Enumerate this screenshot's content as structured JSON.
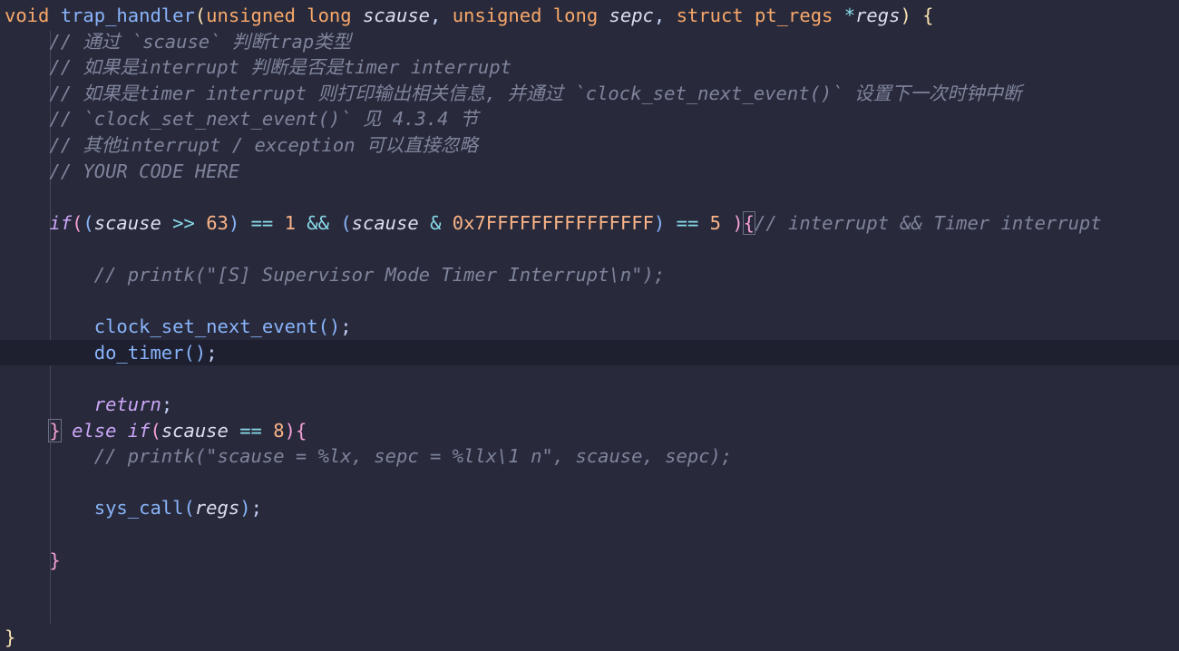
{
  "editor": {
    "lines": [
      {
        "id": "sig",
        "tokens": [
          {
            "c": "type",
            "t": "void"
          },
          {
            "c": "punct",
            "t": " "
          },
          {
            "c": "fn",
            "t": "trap_handler"
          },
          {
            "c": "brace-y",
            "t": "("
          },
          {
            "c": "type",
            "t": "unsigned long"
          },
          {
            "c": "punct",
            "t": " "
          },
          {
            "c": "param",
            "t": "scause"
          },
          {
            "c": "punct",
            "t": ", "
          },
          {
            "c": "type",
            "t": "unsigned long"
          },
          {
            "c": "punct",
            "t": " "
          },
          {
            "c": "param",
            "t": "sepc"
          },
          {
            "c": "punct",
            "t": ", "
          },
          {
            "c": "type",
            "t": "struct"
          },
          {
            "c": "punct",
            "t": " "
          },
          {
            "c": "type",
            "t": "pt_regs"
          },
          {
            "c": "punct",
            "t": " "
          },
          {
            "c": "op",
            "t": "*"
          },
          {
            "c": "param",
            "t": "regs"
          },
          {
            "c": "brace-y",
            "t": ")"
          },
          {
            "c": "punct",
            "t": " "
          },
          {
            "c": "brace-y",
            "t": "{"
          }
        ]
      },
      {
        "id": "c1",
        "tokens": [
          {
            "c": "cmt",
            "t": "    // 通过 `scause` 判断trap类型"
          }
        ]
      },
      {
        "id": "c2",
        "tokens": [
          {
            "c": "cmt",
            "t": "    // 如果是interrupt 判断是否是timer interrupt"
          }
        ]
      },
      {
        "id": "c3",
        "tokens": [
          {
            "c": "cmt",
            "t": "    // 如果是timer interrupt 则打印输出相关信息, 并通过 `clock_set_next_event()` 设置下一次时钟中断"
          }
        ]
      },
      {
        "id": "c4",
        "tokens": [
          {
            "c": "cmt",
            "t": "    // `clock_set_next_event()` 见 4.3.4 节"
          }
        ]
      },
      {
        "id": "c5",
        "tokens": [
          {
            "c": "cmt",
            "t": "    // 其他interrupt / exception 可以直接忽略"
          }
        ]
      },
      {
        "id": "c6",
        "tokens": [
          {
            "c": "cmt",
            "t": "    // YOUR CODE HERE"
          }
        ]
      },
      {
        "id": "blank1",
        "tokens": []
      },
      {
        "id": "if",
        "tokens": [
          {
            "c": "punct",
            "t": "    "
          },
          {
            "c": "kwi",
            "t": "if"
          },
          {
            "c": "brace-m",
            "t": "("
          },
          {
            "c": "brace-b",
            "t": "("
          },
          {
            "c": "param",
            "t": "scause"
          },
          {
            "c": "punct",
            "t": " "
          },
          {
            "c": "op",
            "t": ">>"
          },
          {
            "c": "punct",
            "t": " "
          },
          {
            "c": "num",
            "t": "63"
          },
          {
            "c": "brace-b",
            "t": ")"
          },
          {
            "c": "punct",
            "t": " "
          },
          {
            "c": "op",
            "t": "=="
          },
          {
            "c": "punct",
            "t": " "
          },
          {
            "c": "num",
            "t": "1"
          },
          {
            "c": "punct",
            "t": " "
          },
          {
            "c": "op",
            "t": "&&"
          },
          {
            "c": "punct",
            "t": " "
          },
          {
            "c": "brace-b",
            "t": "("
          },
          {
            "c": "param",
            "t": "scause"
          },
          {
            "c": "punct",
            "t": " "
          },
          {
            "c": "op",
            "t": "&"
          },
          {
            "c": "punct",
            "t": " "
          },
          {
            "c": "num",
            "t": "0x7FFFFFFFFFFFFFFF"
          },
          {
            "c": "brace-b",
            "t": ")"
          },
          {
            "c": "punct",
            "t": " "
          },
          {
            "c": "op",
            "t": "=="
          },
          {
            "c": "punct",
            "t": " "
          },
          {
            "c": "num",
            "t": "5"
          },
          {
            "c": "punct",
            "t": " "
          },
          {
            "c": "brace-m",
            "t": ")"
          },
          {
            "c": "brace-m bracket-match",
            "t": "{"
          },
          {
            "c": "cmt",
            "t": "// interrupt && Timer interrupt"
          }
        ]
      },
      {
        "id": "blank2",
        "tokens": []
      },
      {
        "id": "printk1",
        "tokens": [
          {
            "c": "cmt",
            "t": "        // printk(\"[S] Supervisor Mode Timer Interrupt\\n\");"
          }
        ]
      },
      {
        "id": "blank3",
        "tokens": []
      },
      {
        "id": "csne",
        "tokens": [
          {
            "c": "punct",
            "t": "        "
          },
          {
            "c": "fn",
            "t": "clock_set_next_event"
          },
          {
            "c": "brace-b",
            "t": "()"
          },
          {
            "c": "punct",
            "t": ";"
          }
        ]
      },
      {
        "id": "dotimer",
        "current": true,
        "tokens": [
          {
            "c": "punct",
            "t": "        "
          },
          {
            "c": "fn",
            "t": "do_timer"
          },
          {
            "c": "brace-b",
            "t": "()"
          },
          {
            "c": "punct",
            "t": ";"
          }
        ]
      },
      {
        "id": "blank4",
        "tokens": []
      },
      {
        "id": "ret",
        "tokens": [
          {
            "c": "punct",
            "t": "        "
          },
          {
            "c": "kwi",
            "t": "return"
          },
          {
            "c": "punct",
            "t": ";"
          }
        ]
      },
      {
        "id": "else",
        "tokens": [
          {
            "c": "punct",
            "t": "    "
          },
          {
            "c": "brace-m bracket-match",
            "t": "}"
          },
          {
            "c": "punct",
            "t": " "
          },
          {
            "c": "kwi",
            "t": "else"
          },
          {
            "c": "punct",
            "t": " "
          },
          {
            "c": "kwi",
            "t": "if"
          },
          {
            "c": "brace-m",
            "t": "("
          },
          {
            "c": "param",
            "t": "scause"
          },
          {
            "c": "punct",
            "t": " "
          },
          {
            "c": "op",
            "t": "=="
          },
          {
            "c": "punct",
            "t": " "
          },
          {
            "c": "num",
            "t": "8"
          },
          {
            "c": "brace-m",
            "t": ")"
          },
          {
            "c": "brace-m",
            "t": "{"
          }
        ]
      },
      {
        "id": "printk2",
        "tokens": [
          {
            "c": "cmt",
            "t": "        // printk(\"scause = %lx, sepc = %llx\\1 n\", scause, sepc);"
          }
        ]
      },
      {
        "id": "blank5",
        "tokens": []
      },
      {
        "id": "syscall",
        "tokens": [
          {
            "c": "punct",
            "t": "        "
          },
          {
            "c": "fn",
            "t": "sys_call"
          },
          {
            "c": "brace-b",
            "t": "("
          },
          {
            "c": "param",
            "t": "regs"
          },
          {
            "c": "brace-b",
            "t": ")"
          },
          {
            "c": "punct",
            "t": ";"
          }
        ]
      },
      {
        "id": "blank6",
        "tokens": []
      },
      {
        "id": "close2",
        "tokens": [
          {
            "c": "punct",
            "t": "    "
          },
          {
            "c": "brace-m",
            "t": "}"
          }
        ]
      },
      {
        "id": "blank7",
        "tokens": []
      },
      {
        "id": "blank8",
        "tokens": []
      },
      {
        "id": "close1",
        "tokens": [
          {
            "c": "brace-y",
            "t": "}"
          }
        ]
      }
    ]
  }
}
